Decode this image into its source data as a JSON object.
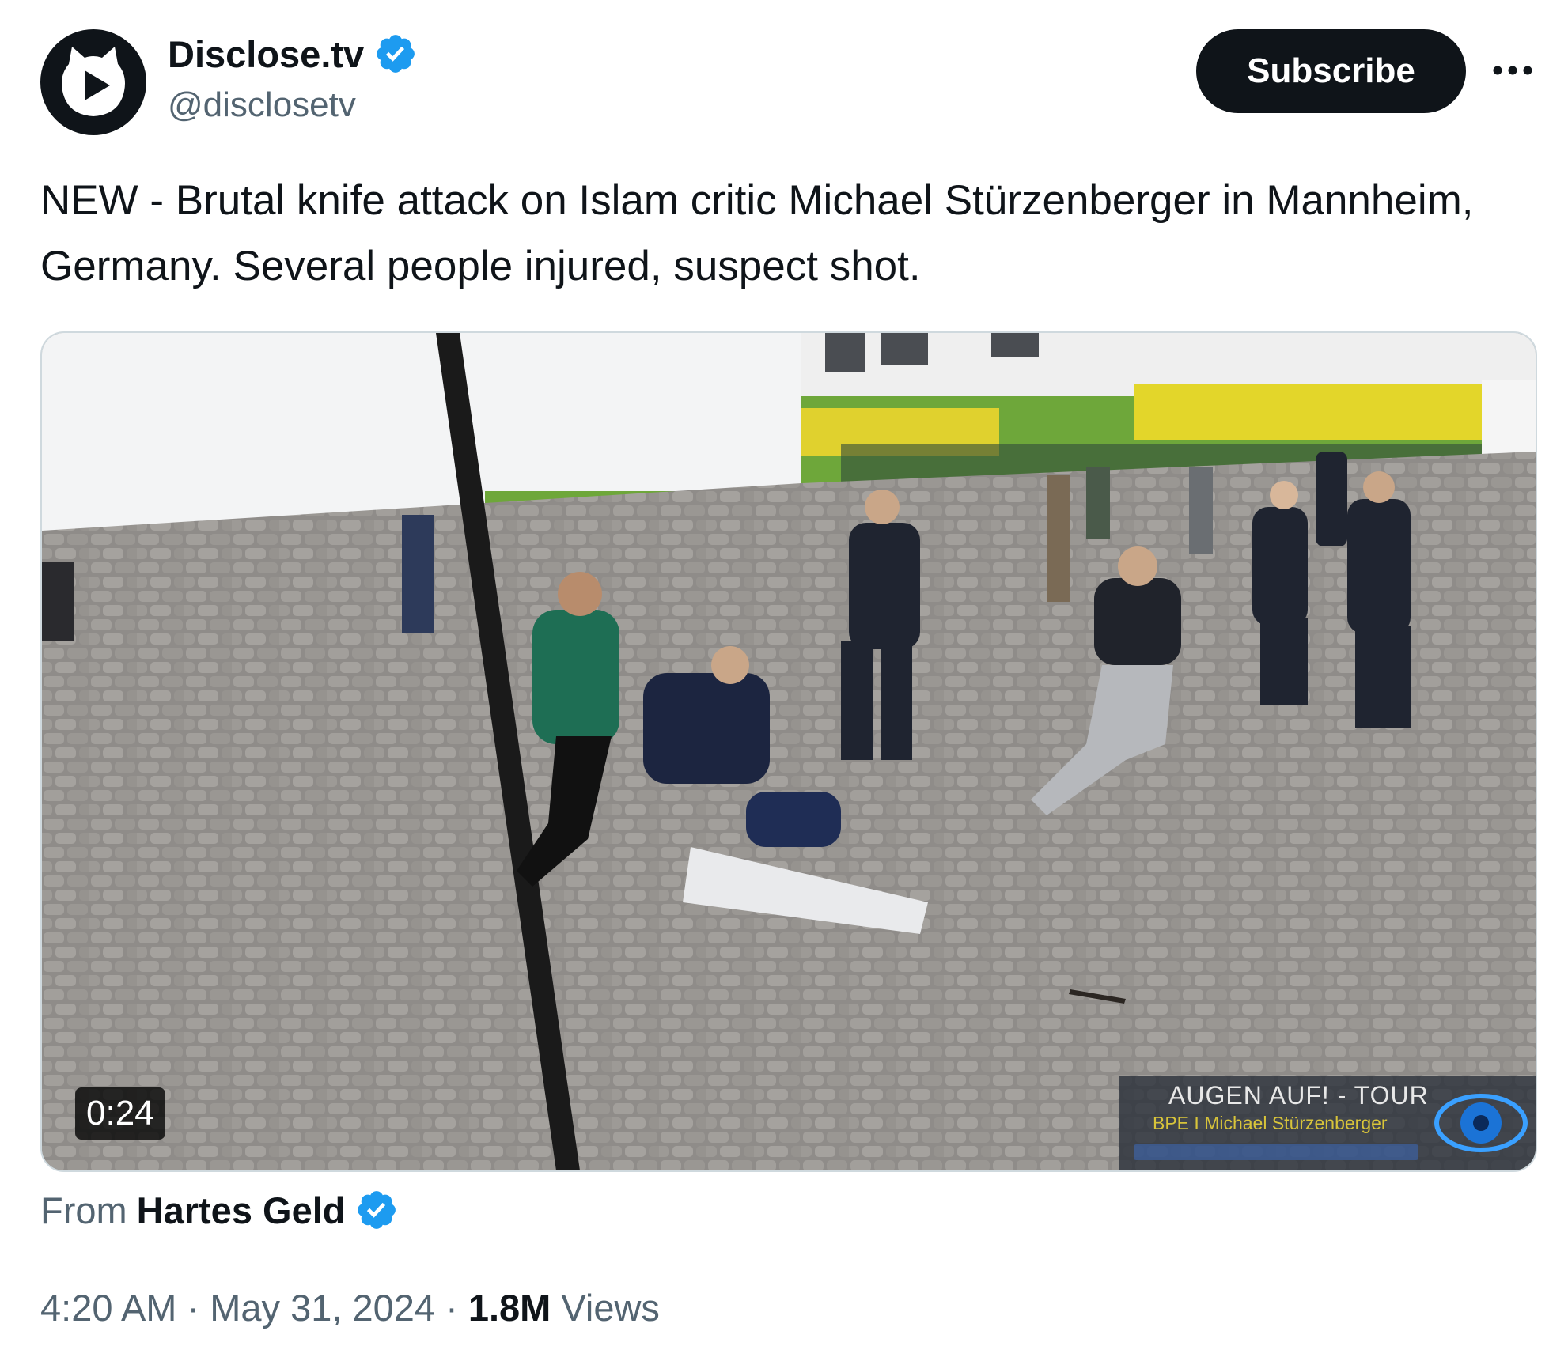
{
  "author": {
    "display_name": "Disclose.tv",
    "handle": "@disclosetv",
    "verified": true,
    "avatar_icon": "play-cat-logo-icon"
  },
  "actions": {
    "subscribe_label": "Subscribe",
    "more_icon": "more-dots-icon"
  },
  "tweet": {
    "text": "NEW - Brutal knife attack on Islam critic Michael Stürzenberger in Mannheim, Germany. Several people injured, suspect shot."
  },
  "media": {
    "duration": "0:24",
    "watermark": {
      "title": "AUGEN AUF! - TOUR",
      "subtitle": "BPE I Michael Stürzenberger"
    }
  },
  "source": {
    "from_label": "From",
    "name": "Hartes Geld",
    "verified": true
  },
  "meta": {
    "time": "4:20 AM",
    "separator": " · ",
    "date": "May 31, 2024",
    "views_count": "1.8M",
    "views_label": "Views"
  },
  "colors": {
    "verified_blue": "#1d9bf0",
    "text_primary": "#0f1419",
    "text_secondary": "#536471",
    "button_bg": "#0f1419"
  }
}
